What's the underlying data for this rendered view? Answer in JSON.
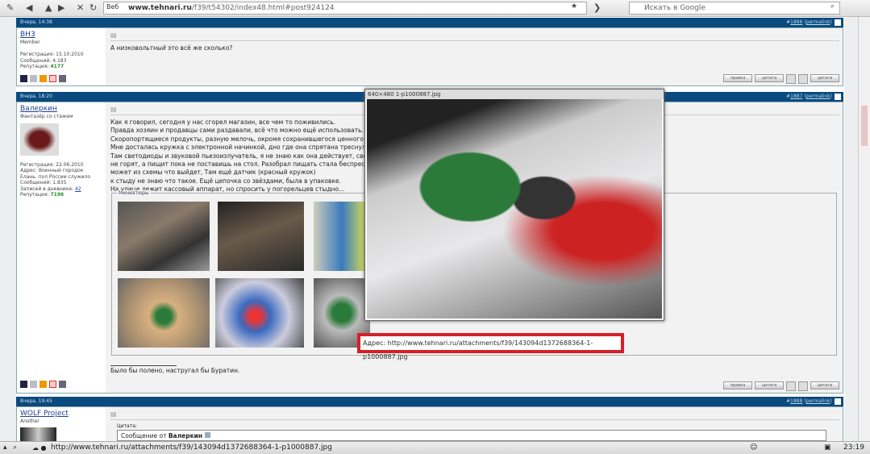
{
  "browser": {
    "url_badge": "Веб",
    "url_domain": "www.tehnari.ru",
    "url_path": "/f39/t54302/index48.html#post924124",
    "search_placeholder": "Искать в Google",
    "status_url": "http://www.tehnari.ru/attachments/f39/143094d1372688364-1-p1000887.jpg",
    "clock": "23:19"
  },
  "posts": [
    {
      "date": "Вчера, 14:38",
      "number": "1886",
      "permalink": "permalink",
      "user": "ВН3",
      "rank": "Member",
      "info": [
        "Регистрация: 15.10.2010",
        "Сообщений: 4.183"
      ],
      "rep_label": "Репутация: ",
      "rep": "4177",
      "text_pre": "А ",
      "text_em": "низковольтный",
      "text_post": " это всё же сколько?"
    },
    {
      "date": "Вчера, 18:20",
      "number": "1887",
      "permalink": "permalink",
      "user": "Валеркин",
      "rank": "Фантазёр со стажем",
      "info": [
        "Регистрация: 22.06.2010",
        "Адрес: Военный городок",
        "Елань. пол России служило",
        "Сообщений: 1.835"
      ],
      "diary_label": "Записей в дневнике: ",
      "diary": "42",
      "rep_label": "Репутация: ",
      "rep": "7196",
      "lines": [
        "Как я говорил, сегодня у нас сгорел магазин, все чем то поживились.",
        "Правда хозяин и продавцы сами раздавали, всё что можно ещё использовать.",
        "Скоропортящиеся продукты, разную мелочь, окромя сохранившегося ценного ко",
        "Мне досталась кружка с электронной начинкой, дно где она спрятана треснуло",
        "Там светодиоды и звуковой пьезоизлучатель, я не знаю как она действует, све",
        "не горят, а пищит пока не поставишь на стол. Разобрал пищать стала беспрес",
        "может из схемы что выйдет, Там ещё датчик (красный кружок)",
        "к стыду не знаю что такое. Ещё цепочка со звёздами, была в упаковке.",
        "На улице лежит кассовый аппарат, но спросить у погорельцев стыдно..."
      ],
      "thumbs_legend": "Миниатюры",
      "signature": "Было бы полено, настругал бы Буратин."
    },
    {
      "date": "Вчера, 19:45",
      "number": "1888",
      "permalink": "permalink",
      "user": "WOLF Project",
      "rank": "Another",
      "quote_label": "Цитата:",
      "quote_from": "Сообщение от ",
      "quote_author": "Валеркин"
    }
  ],
  "buttons": {
    "edit": "правка",
    "quote": "цитата",
    "quote2": "цитата"
  },
  "popup": {
    "caption": "640×480 1-p1000887.jpg",
    "address_label": "Адрес: ",
    "address": "http://www.tehnari.ru/attachments/f39/143094d1372688364-1-p1000887.jpg"
  },
  "colors": {
    "header": "#0b4a7e",
    "highlight": "#d62027"
  }
}
